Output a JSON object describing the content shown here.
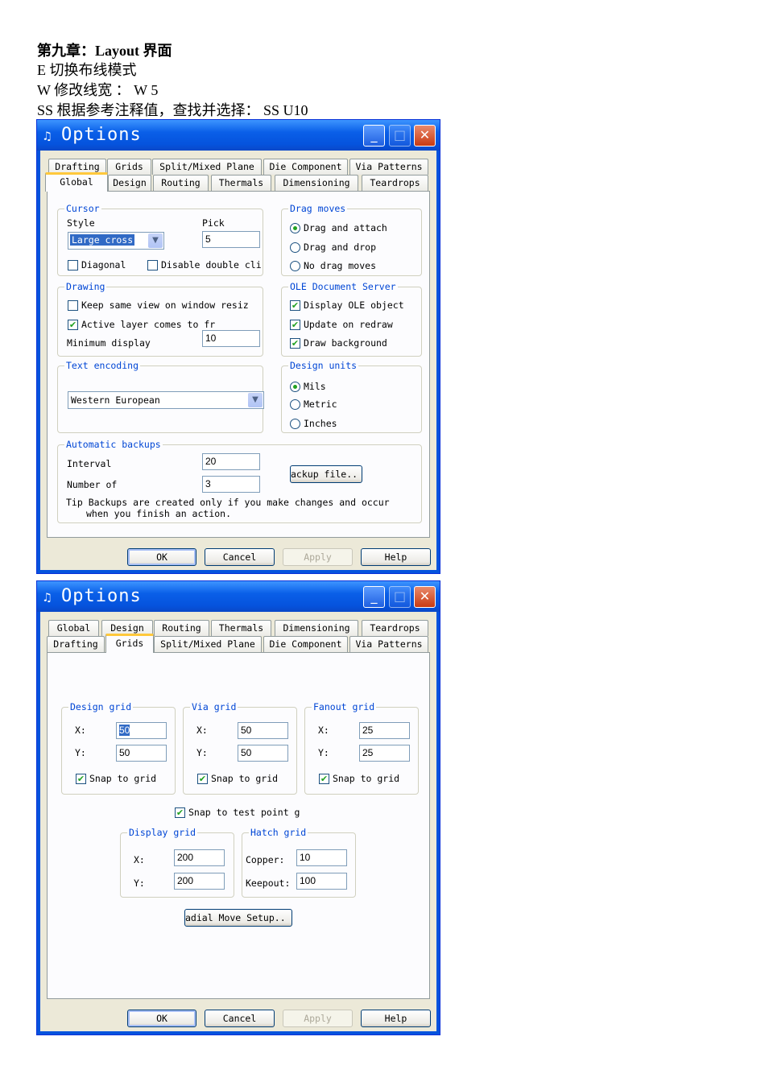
{
  "doc": {
    "heading": "第九章：Layout 界面",
    "line1": "E  切换布线模式",
    "line2": "W  修改线宽  ：  W 5",
    "line3": "SS  根据参考注释值，查找并选择：   SS U10"
  },
  "dialog": {
    "title": "Options",
    "icon": "♫",
    "min": "_",
    "max": "□",
    "close": "✕"
  },
  "tabs": {
    "global": "Global",
    "design": "Design",
    "routing": "Routing",
    "thermals": "Thermals",
    "dimensioning": "Dimensioning",
    "teardrops": "Teardrops",
    "drafting": "Drafting",
    "grids": "Grids",
    "split": "Split/Mixed Plane",
    "die": "Die Component",
    "via": "Via Patterns"
  },
  "global": {
    "cursor": {
      "legend": "Cursor",
      "style_label": "Style",
      "style_value": "Large cross",
      "pick_label": "Pick",
      "pick_value": "5",
      "diagonal": "Diagonal",
      "disable_dbl": "Disable double cli"
    },
    "drag": {
      "legend": "Drag moves",
      "opt1": "Drag and attach",
      "opt2": "Drag and drop",
      "opt3": "No drag moves"
    },
    "drawing": {
      "legend": "Drawing",
      "keep": "Keep same view on window resiz",
      "active": "Active layer comes to fr",
      "min_label": "Minimum display",
      "min_value": "10"
    },
    "ole": {
      "legend": "OLE Document Server",
      "display": "Display OLE object",
      "update": "Update on redraw",
      "bg": "Draw background"
    },
    "encoding": {
      "legend": "Text encoding",
      "value": "Western European"
    },
    "units": {
      "legend": "Design units",
      "mils": "Mils",
      "metric": "Metric",
      "inches": "Inches"
    },
    "backups": {
      "legend": "Automatic backups",
      "interval_label": "Interval",
      "interval_value": "20",
      "number_label": "Number of",
      "number_value": "3",
      "button": "ackup file..",
      "tip1": "Tip Backups are created only if you make changes and occur",
      "tip2": "when you finish an action."
    }
  },
  "grids": {
    "design": {
      "legend": "Design grid",
      "x": "50",
      "y": "50",
      "snap": "Snap to grid"
    },
    "via": {
      "legend": "Via grid",
      "x": "50",
      "y": "50",
      "snap": "Snap to grid"
    },
    "fanout": {
      "legend": "Fanout grid",
      "x": "25",
      "y": "25",
      "snap": "Snap to grid"
    },
    "x_label": "X:",
    "y_label": "Y:",
    "snap_test": "Snap to test point g",
    "display": {
      "legend": "Display grid",
      "x": "200",
      "y": "200"
    },
    "hatch": {
      "legend": "Hatch grid",
      "copper_label": "Copper:",
      "copper": "10",
      "keepout_label": "Keepout:",
      "keepout": "100"
    },
    "radial": "adial Move Setup.."
  },
  "buttons": {
    "ok": "OK",
    "cancel": "Cancel",
    "apply": "Apply",
    "help": "Help"
  }
}
